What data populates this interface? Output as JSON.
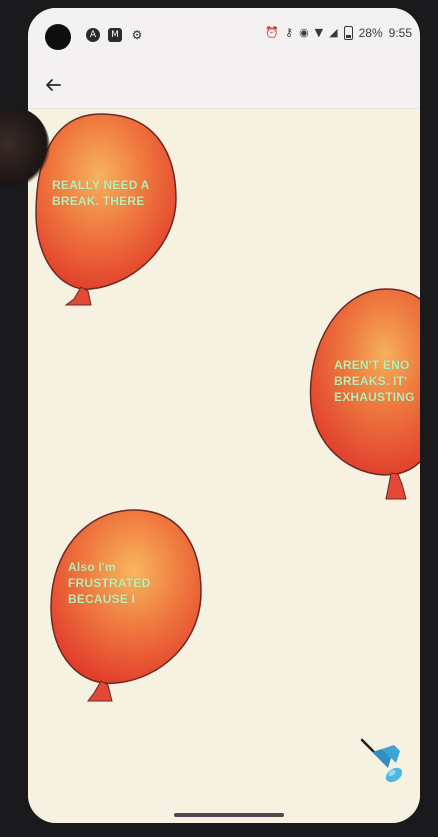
{
  "status_bar": {
    "left_icons": [
      "a-icon",
      "m-icon",
      "settings-icon"
    ],
    "right_icons": [
      "alarm-icon",
      "key-icon",
      "eye-icon",
      "wifi-icon",
      "signal-icon",
      "battery-icon"
    ],
    "battery_percent": "28%",
    "time": "9:55"
  },
  "app_bar": {
    "back_icon": "back-arrow-icon"
  },
  "balloons": [
    {
      "name": "balloon-1",
      "text": "REALLY NEED A\nBREAK. THERE"
    },
    {
      "name": "balloon-2",
      "text": "AREN'T ENO\nBREAKS. IT'\nEXHAUSTING"
    },
    {
      "name": "balloon-3",
      "text": "Also I'm\nFRUSTRATED\nBECAUSE I"
    }
  ],
  "pin": {
    "icon": "pushpin-icon",
    "color": "#3da5d6"
  },
  "colors": {
    "balloon_fill": "#e9522f",
    "balloon_highlight": "#f6b25a",
    "label_text": "#b9f0b8",
    "background": "#f6f1e1"
  }
}
